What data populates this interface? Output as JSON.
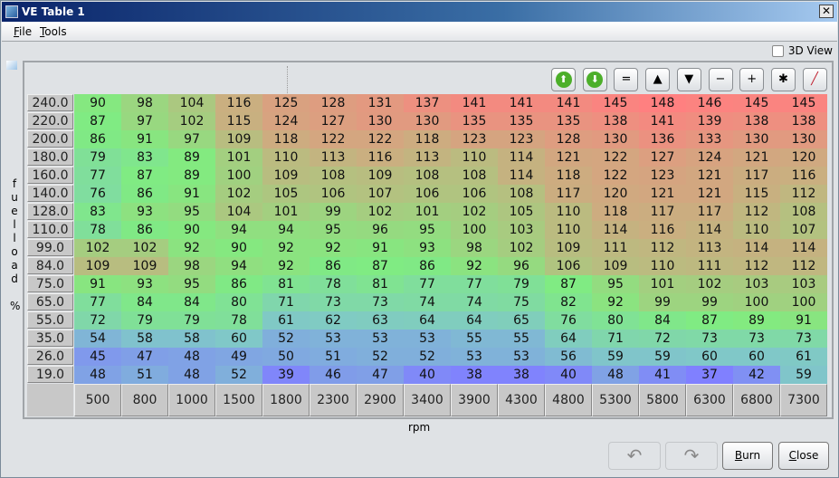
{
  "window": {
    "title": "VE Table 1"
  },
  "menu": [
    {
      "label": "File",
      "mn": "F",
      "rest": "ile"
    },
    {
      "label": "Tools",
      "mn": "T",
      "rest": "ools"
    }
  ],
  "view3d": {
    "label": "3D View",
    "checked": false
  },
  "toolbar": [
    {
      "name": "increment-green-button",
      "icon": "up-circle-icon",
      "glyph": "⬆"
    },
    {
      "name": "decrement-green-button",
      "icon": "down-circle-icon",
      "glyph": "⬇"
    },
    {
      "name": "set-equal-button",
      "icon": "equals-icon",
      "glyph": "="
    },
    {
      "name": "increase-button",
      "icon": "triangle-up-icon",
      "glyph": "▲"
    },
    {
      "name": "decrease-button",
      "icon": "triangle-down-icon",
      "glyph": "▼"
    },
    {
      "name": "subtract-button",
      "icon": "minus-icon",
      "glyph": "−"
    },
    {
      "name": "add-button",
      "icon": "plus-icon",
      "glyph": "+"
    },
    {
      "name": "multiply-button",
      "icon": "asterisk-icon",
      "glyph": "✱"
    },
    {
      "name": "interpolate-button",
      "icon": "pen-icon",
      "glyph": "╱"
    }
  ],
  "y_axis": {
    "label": [
      "f",
      "u",
      "e",
      "l",
      "l",
      "o",
      "a",
      "d",
      "",
      "%"
    ],
    "values": [
      "240.0",
      "220.0",
      "200.0",
      "180.0",
      "160.0",
      "140.0",
      "128.0",
      "110.0",
      "99.0",
      "84.0",
      "75.0",
      "65.0",
      "55.0",
      "35.0",
      "26.0",
      "19.0"
    ]
  },
  "x_axis": {
    "label": "rpm",
    "values": [
      "500",
      "800",
      "1000",
      "1500",
      "1800",
      "2300",
      "2900",
      "3400",
      "3900",
      "4300",
      "4800",
      "5300",
      "5800",
      "6300",
      "6800",
      "7300"
    ]
  },
  "table": [
    [
      90,
      98,
      104,
      116,
      125,
      128,
      131,
      137,
      141,
      141,
      141,
      145,
      148,
      146,
      145,
      145
    ],
    [
      87,
      97,
      102,
      115,
      124,
      127,
      130,
      130,
      135,
      135,
      135,
      138,
      141,
      139,
      138,
      138
    ],
    [
      86,
      91,
      97,
      109,
      118,
      122,
      122,
      118,
      123,
      123,
      128,
      130,
      136,
      133,
      130,
      130
    ],
    [
      79,
      83,
      89,
      101,
      110,
      113,
      116,
      113,
      110,
      114,
      121,
      122,
      127,
      124,
      121,
      120
    ],
    [
      77,
      87,
      89,
      100,
      109,
      108,
      109,
      108,
      108,
      114,
      118,
      122,
      123,
      121,
      117,
      116
    ],
    [
      76,
      86,
      91,
      102,
      105,
      106,
      107,
      106,
      106,
      108,
      117,
      120,
      121,
      121,
      115,
      112
    ],
    [
      83,
      93,
      95,
      104,
      101,
      99,
      102,
      101,
      102,
      105,
      110,
      118,
      117,
      117,
      112,
      108
    ],
    [
      78,
      86,
      90,
      94,
      94,
      95,
      96,
      95,
      100,
      103,
      110,
      114,
      116,
      114,
      110,
      107
    ],
    [
      102,
      102,
      92,
      90,
      92,
      92,
      91,
      93,
      98,
      102,
      109,
      111,
      112,
      113,
      114,
      114
    ],
    [
      109,
      109,
      98,
      94,
      92,
      86,
      87,
      86,
      92,
      96,
      106,
      109,
      110,
      111,
      112,
      112
    ],
    [
      91,
      93,
      95,
      86,
      81,
      78,
      81,
      77,
      77,
      79,
      87,
      95,
      101,
      102,
      103,
      103
    ],
    [
      77,
      84,
      84,
      80,
      71,
      73,
      73,
      74,
      74,
      75,
      82,
      92,
      99,
      99,
      100,
      100
    ],
    [
      72,
      79,
      79,
      78,
      61,
      62,
      63,
      64,
      64,
      65,
      76,
      80,
      84,
      87,
      89,
      91
    ],
    [
      54,
      58,
      58,
      60,
      52,
      53,
      53,
      53,
      55,
      55,
      64,
      71,
      72,
      73,
      73,
      73
    ],
    [
      45,
      47,
      48,
      49,
      50,
      51,
      52,
      52,
      53,
      53,
      56,
      59,
      59,
      60,
      60,
      61
    ],
    [
      48,
      51,
      48,
      52,
      39,
      46,
      47,
      40,
      38,
      38,
      40,
      48,
      41,
      37,
      42,
      59
    ]
  ],
  "colors": {
    "low": "#8080ff",
    "mid_low": "#80c8c8",
    "mid": "#80ec80",
    "mid_high": "#c8b080",
    "high": "#ff8080"
  },
  "buttons": {
    "undo_icon": "undo-icon",
    "redo_icon": "redo-icon",
    "burn": {
      "mn": "B",
      "rest": "urn",
      "label": "Burn"
    },
    "close": {
      "mn": "C",
      "rest": "lose",
      "label": "Close"
    }
  }
}
